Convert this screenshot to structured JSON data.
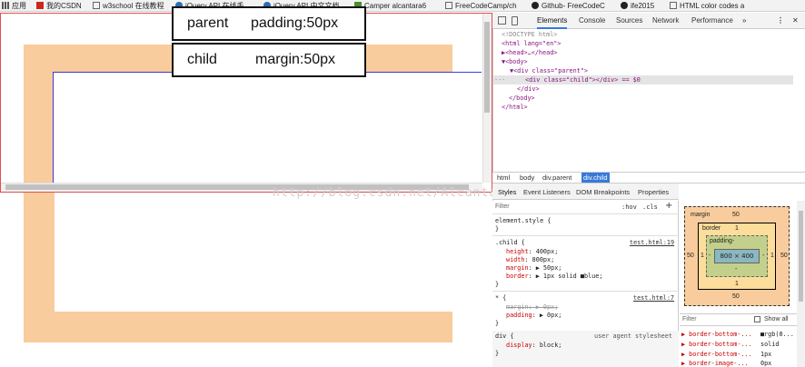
{
  "bookmarks": [
    {
      "label": "应用",
      "icon": "apps-icon"
    },
    {
      "label": "我的CSDN",
      "icon": "csdn-icon"
    },
    {
      "label": "w3school 在线教程",
      "icon": "page-icon"
    },
    {
      "label": "jQuery API 在线手",
      "icon": "jquery-icon"
    },
    {
      "label": "jQuery API 中文文档",
      "icon": "jquery-icon"
    },
    {
      "label": "Camper alcantara6",
      "icon": "fcc-icon"
    },
    {
      "label": "FreeCodeCamp/ch",
      "icon": "page-icon"
    },
    {
      "label": "Github- FreeCodeC",
      "icon": "github-icon"
    },
    {
      "label": "ife2015",
      "icon": "github-icon"
    },
    {
      "label": "HTML color codes a",
      "icon": "page-icon"
    }
  ],
  "annotations": {
    "parent": {
      "name": "parent",
      "value": "padding:50px"
    },
    "child": {
      "name": "child",
      "value": "margin:50px"
    }
  },
  "watermark": "http://blog.csdn.net/Alcantara",
  "devtools": {
    "tabs": [
      "Elements",
      "Console",
      "Sources",
      "Network",
      "Performance",
      "»"
    ],
    "active_tab": "Elements",
    "dom_lines": [
      "<!DOCTYPE html>",
      "<html lang=\"en\">",
      "▶<head>…</head>",
      "▼<body>",
      "▼<div class=\"parent\">",
      "<div class=\"child\"></div> == $0",
      "</div>",
      "</body>",
      "</html>"
    ],
    "crumbs": [
      "html",
      "body",
      "div.parent",
      "div.child"
    ],
    "subtabs": [
      "Styles",
      "Event Listeners",
      "DOM Breakpoints",
      "Properties"
    ],
    "filter_placeholder": "Filter",
    "hov": ":hov",
    "cls": ".cls",
    "plus": "+",
    "element_style": "element.style {",
    "close_brace": "}",
    "child_rule": {
      "selector": ".child {",
      "link": "test.html:19",
      "props": [
        {
          "name": "height",
          "value": "400px;"
        },
        {
          "name": "width",
          "value": "800px;"
        },
        {
          "name": "margin",
          "value": "▶ 50px;"
        },
        {
          "name": "border",
          "value": "▶ 1px solid ■blue;"
        }
      ]
    },
    "star_rule": {
      "selector": "* {",
      "link": "test.html:7",
      "props": [
        {
          "name": "margin",
          "value": "▶ 0px;",
          "struck": true
        },
        {
          "name": "padding",
          "value": "▶ 0px;",
          "struck": false
        }
      ]
    },
    "ua_rule": {
      "selector": "div {",
      "label": "user agent stylesheet",
      "props": [
        {
          "name": "display",
          "value": "block;"
        }
      ]
    },
    "box_model": {
      "margin_label": "margin",
      "margin_top": "50",
      "margin_bottom": "50",
      "margin_left": "50",
      "margin_right": "50",
      "border_label": "border",
      "border_top": "1",
      "border_bottom": "1",
      "border_left": "1",
      "border_right": "1",
      "padding_label": "padding-",
      "padding_side": "-",
      "padding_bottom": "-",
      "content": "800 × 400"
    },
    "computed_filter": "Filter",
    "show_all": "Show all",
    "computed": [
      {
        "name": "▶ border-bottom-...",
        "value": "■rgb(0..."
      },
      {
        "name": "▶ border-bottom-...",
        "value": "solid"
      },
      {
        "name": "▶ border-bottom-...",
        "value": "1px"
      },
      {
        "name": "▶ border-image-...",
        "value": "0px"
      }
    ]
  },
  "colors": {
    "margin_shade": "#f8cc9d",
    "child_border": "#3b3bd8",
    "selection": "#3879d9"
  }
}
